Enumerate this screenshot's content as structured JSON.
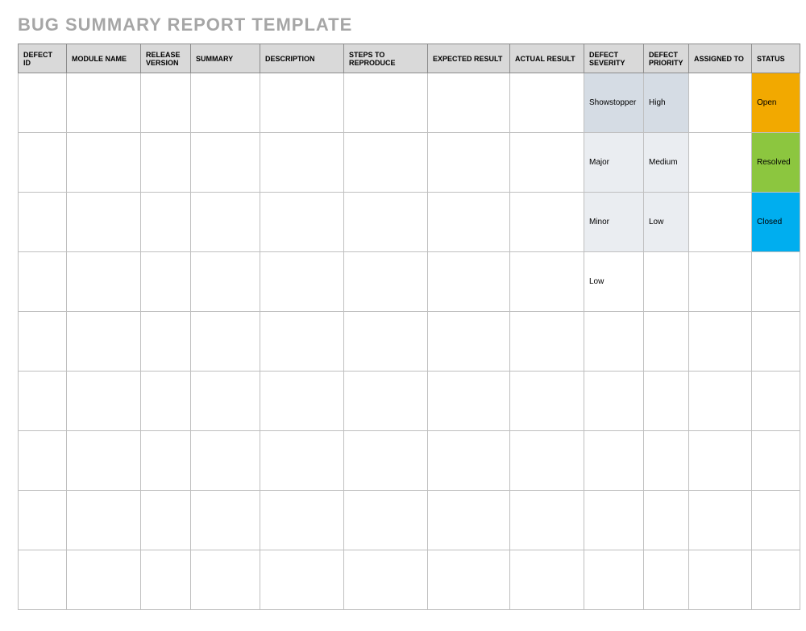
{
  "title": "BUG SUMMARY REPORT TEMPLATE",
  "columns": [
    "DEFECT ID",
    "MODULE NAME",
    "RELEASE VERSION",
    "SUMMARY",
    "DESCRIPTION",
    "STEPS TO REPRODUCE",
    "EXPECTED RESULT",
    "ACTUAL RESULT",
    "DEFECT SEVERITY",
    "DEFECT PRIORITY",
    "ASSIGNED TO",
    "STATUS"
  ],
  "colors": {
    "severity_priority_fill_dark": "#d5dce4",
    "severity_priority_fill_light": "#eaedf1",
    "status_open": "#f2a900",
    "status_resolved": "#8cc63f",
    "status_closed": "#00aeef"
  },
  "rows": [
    {
      "defect_id": "",
      "module_name": "",
      "release_version": "",
      "summary": "",
      "description": "",
      "steps_to_reproduce": "",
      "expected_result": "",
      "actual_result": "",
      "defect_severity": "Showstopper",
      "severity_bg": "#d5dce4",
      "defect_priority": "High",
      "priority_bg": "#d5dce4",
      "assigned_to": "",
      "status": "Open",
      "status_bg": "#f2a900"
    },
    {
      "defect_id": "",
      "module_name": "",
      "release_version": "",
      "summary": "",
      "description": "",
      "steps_to_reproduce": "",
      "expected_result": "",
      "actual_result": "",
      "defect_severity": "Major",
      "severity_bg": "#eaedf1",
      "defect_priority": "Medium",
      "priority_bg": "#eaedf1",
      "assigned_to": "",
      "status": "Resolved",
      "status_bg": "#8cc63f"
    },
    {
      "defect_id": "",
      "module_name": "",
      "release_version": "",
      "summary": "",
      "description": "",
      "steps_to_reproduce": "",
      "expected_result": "",
      "actual_result": "",
      "defect_severity": "Minor",
      "severity_bg": "#eaedf1",
      "defect_priority": "Low",
      "priority_bg": "#eaedf1",
      "assigned_to": "",
      "status": "Closed",
      "status_bg": "#00aeef"
    },
    {
      "defect_id": "",
      "module_name": "",
      "release_version": "",
      "summary": "",
      "description": "",
      "steps_to_reproduce": "",
      "expected_result": "",
      "actual_result": "",
      "defect_severity": "Low",
      "severity_bg": "",
      "defect_priority": "",
      "priority_bg": "",
      "assigned_to": "",
      "status": "",
      "status_bg": ""
    },
    {
      "defect_id": "",
      "module_name": "",
      "release_version": "",
      "summary": "",
      "description": "",
      "steps_to_reproduce": "",
      "expected_result": "",
      "actual_result": "",
      "defect_severity": "",
      "severity_bg": "",
      "defect_priority": "",
      "priority_bg": "",
      "assigned_to": "",
      "status": "",
      "status_bg": ""
    },
    {
      "defect_id": "",
      "module_name": "",
      "release_version": "",
      "summary": "",
      "description": "",
      "steps_to_reproduce": "",
      "expected_result": "",
      "actual_result": "",
      "defect_severity": "",
      "severity_bg": "",
      "defect_priority": "",
      "priority_bg": "",
      "assigned_to": "",
      "status": "",
      "status_bg": ""
    },
    {
      "defect_id": "",
      "module_name": "",
      "release_version": "",
      "summary": "",
      "description": "",
      "steps_to_reproduce": "",
      "expected_result": "",
      "actual_result": "",
      "defect_severity": "",
      "severity_bg": "",
      "defect_priority": "",
      "priority_bg": "",
      "assigned_to": "",
      "status": "",
      "status_bg": ""
    },
    {
      "defect_id": "",
      "module_name": "",
      "release_version": "",
      "summary": "",
      "description": "",
      "steps_to_reproduce": "",
      "expected_result": "",
      "actual_result": "",
      "defect_severity": "",
      "severity_bg": "",
      "defect_priority": "",
      "priority_bg": "",
      "assigned_to": "",
      "status": "",
      "status_bg": ""
    },
    {
      "defect_id": "",
      "module_name": "",
      "release_version": "",
      "summary": "",
      "description": "",
      "steps_to_reproduce": "",
      "expected_result": "",
      "actual_result": "",
      "defect_severity": "",
      "severity_bg": "",
      "defect_priority": "",
      "priority_bg": "",
      "assigned_to": "",
      "status": "",
      "status_bg": ""
    }
  ]
}
